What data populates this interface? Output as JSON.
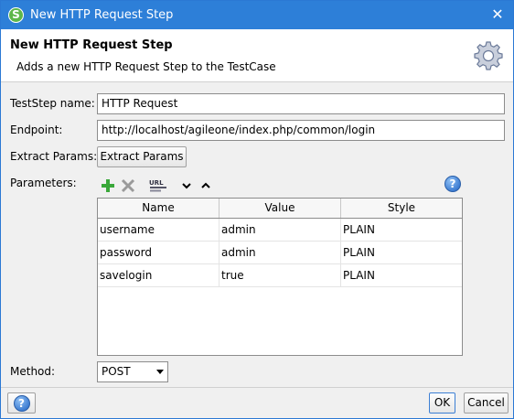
{
  "window": {
    "title": "New HTTP Request Step",
    "app_icon_letter": "S"
  },
  "header": {
    "title": "New HTTP Request Step",
    "description": "Adds a new HTTP Request Step to the TestCase"
  },
  "form": {
    "teststep_name_label": "TestStep name:",
    "teststep_name_value": "HTTP Request",
    "endpoint_label": "Endpoint:",
    "endpoint_value": "http://localhost/agileone/index.php/common/login",
    "extract_params_label": "Extract Params:",
    "extract_params_button": "Extract Params",
    "parameters_label": "Parameters:",
    "method_label": "Method:",
    "method_value": "POST"
  },
  "parameters_toolbar": {
    "icons": [
      "add-icon",
      "remove-icon",
      "url-encode-icon",
      "move-down-icon",
      "move-up-icon"
    ]
  },
  "parameters_table": {
    "columns": [
      "Name",
      "Value",
      "Style"
    ],
    "rows": [
      {
        "name": "username",
        "value": "admin",
        "style": "PLAIN"
      },
      {
        "name": "password",
        "value": "admin",
        "style": "PLAIN"
      },
      {
        "name": "savelogin",
        "value": "true",
        "style": "PLAIN"
      }
    ]
  },
  "footer": {
    "ok_label": "OK",
    "cancel_label": "Cancel"
  },
  "colors": {
    "titlebar": "#2d7fd8",
    "add_icon": "#3aa83a",
    "remove_icon": "#9a9a9a",
    "help_icon": "#1f63c4"
  }
}
